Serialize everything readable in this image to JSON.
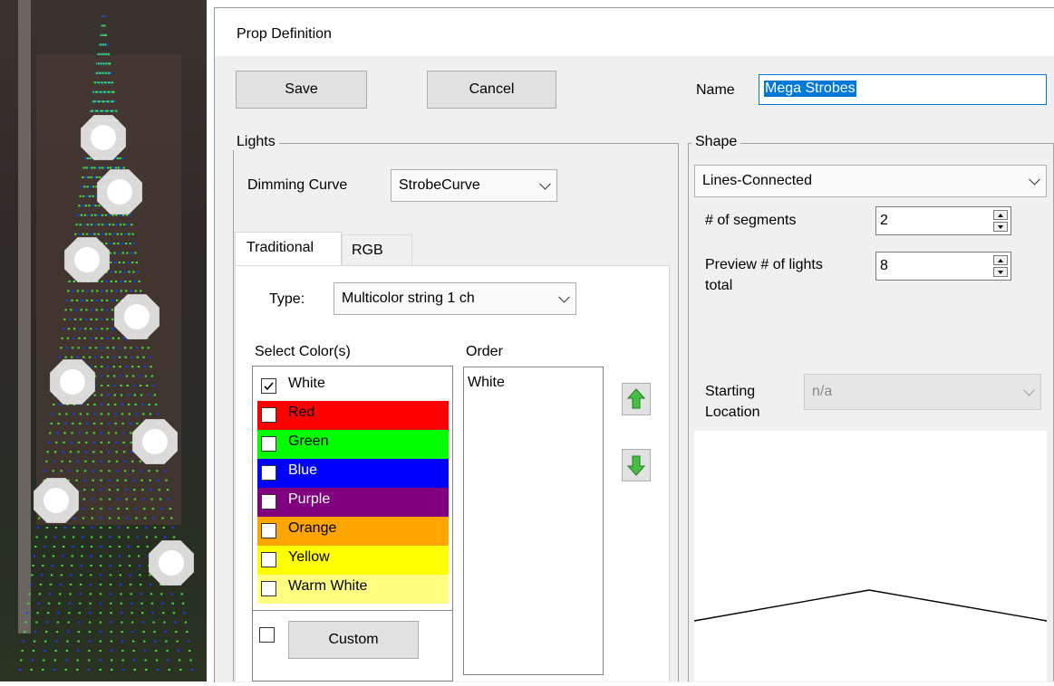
{
  "dialog": {
    "title": "Prop Definition",
    "save_label": "Save",
    "cancel_label": "Cancel",
    "name_label": "Name",
    "name_value": "Mega Strobes"
  },
  "lights": {
    "group_label": "Lights",
    "dimming_label": "Dimming Curve",
    "dimming_value": "StrobeCurve",
    "tabs": [
      {
        "label": "Traditional"
      },
      {
        "label": "RGB"
      }
    ],
    "type_label": "Type:",
    "type_value": "Multicolor string 1 ch",
    "select_colors_label": "Select Color(s)",
    "order_label": "Order",
    "colors": [
      {
        "label": "White",
        "checked": true,
        "bg": "#ffffff",
        "fg": "#000000"
      },
      {
        "label": "Red",
        "checked": false,
        "bg": "#ff0000",
        "fg": "#000000"
      },
      {
        "label": "Green",
        "checked": false,
        "bg": "#00ff00",
        "fg": "#000000"
      },
      {
        "label": "Blue",
        "checked": false,
        "bg": "#0000ff",
        "fg": "#ffffff"
      },
      {
        "label": "Purple",
        "checked": false,
        "bg": "#800080",
        "fg": "#ffffff"
      },
      {
        "label": "Orange",
        "checked": false,
        "bg": "#ffa500",
        "fg": "#000000"
      },
      {
        "label": "Yellow",
        "checked": false,
        "bg": "#ffff00",
        "fg": "#000000"
      },
      {
        "label": "Warm White",
        "checked": false,
        "bg": "#ffff80",
        "fg": "#000000"
      }
    ],
    "order_items": [
      "White"
    ],
    "custom_label": "Custom",
    "up_icon": "green-up-arrow-icon",
    "down_icon": "green-down-arrow-icon"
  },
  "shape": {
    "group_label": "Shape",
    "shape_value": "Lines-Connected",
    "segments_label": "# of segments",
    "segments_value": "2",
    "preview_label_1": "Preview # of lights",
    "preview_label_2": "total",
    "preview_value": "8",
    "starting_label_1": "Starting",
    "starting_label_2": "Location",
    "starting_value": "n/a"
  },
  "colors": {
    "dialog_bg": "#f0f0f0",
    "selection": "#0078d7",
    "arrow_green": "#3cb43c"
  }
}
